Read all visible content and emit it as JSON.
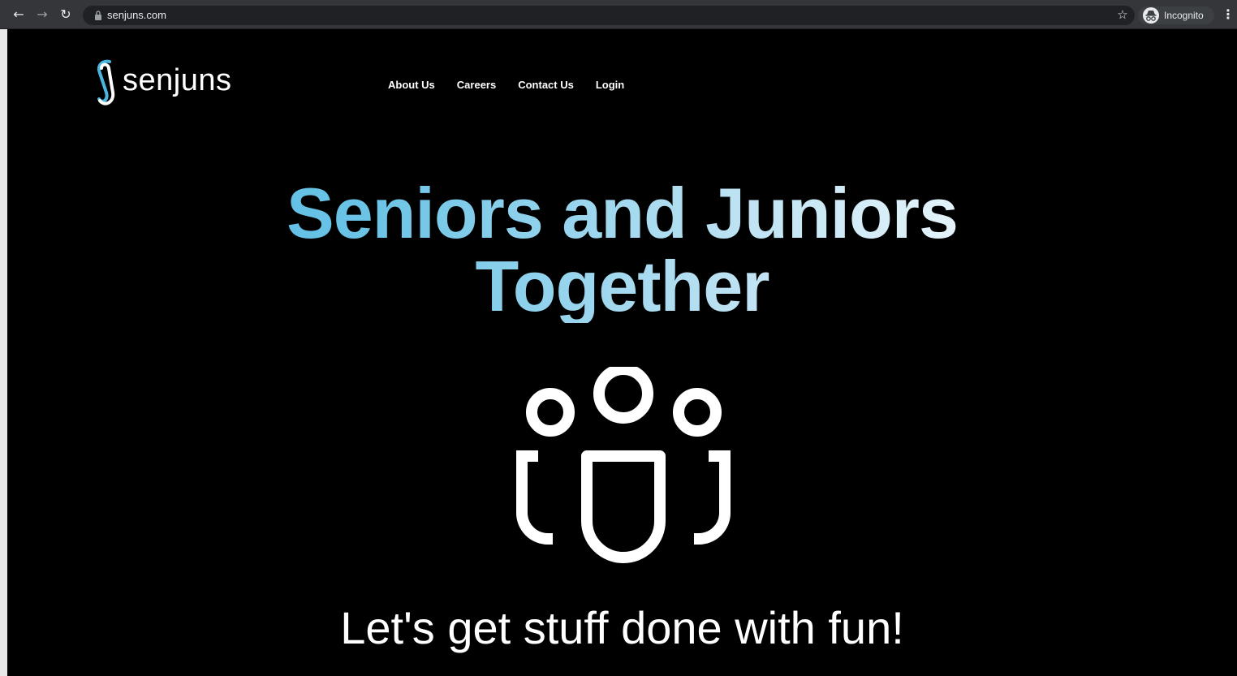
{
  "browser": {
    "url": "senjuns.com",
    "mode_label": "Incognito",
    "icons": [
      "back-icon",
      "forward-icon",
      "reload-icon",
      "lock-icon",
      "star-icon",
      "incognito-icon",
      "menu-icon"
    ]
  },
  "site": {
    "logo_text": "senjuns",
    "nav": [
      "About Us",
      "Careers",
      "Contact Us",
      "Login"
    ],
    "hero_line1": "Seniors and Juniors",
    "hero_line2": "Together",
    "tagline": "Let's get stuff done with fun!",
    "hero_icon": "group-people-icon"
  },
  "colors": {
    "background": "#000000",
    "accent_blue": "#4ab6e0",
    "text": "#ffffff"
  }
}
